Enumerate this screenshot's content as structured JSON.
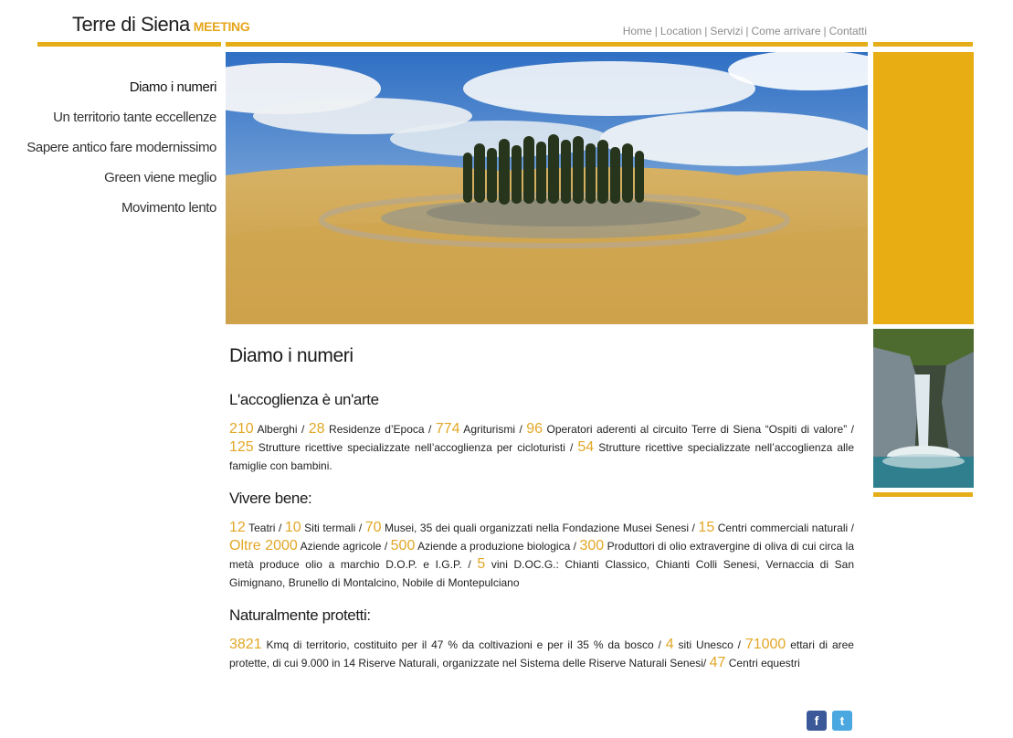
{
  "header": {
    "logo_main": "Terre di Siena",
    "logo_sub": "MEETING",
    "nav": [
      "Home",
      "Location",
      "Servizi",
      "Come arrivare",
      "Contatti"
    ]
  },
  "leftmenu": [
    "Diamo i numeri",
    "Un territorio tante eccellenze",
    "Sapere antico fare modernissimo",
    "Green viene meglio",
    "Movimento lento"
  ],
  "content": {
    "title": "Diamo i numeri",
    "sections": [
      {
        "heading": "L'accoglienza è un'arte",
        "parts": [
          [
            "210",
            " Alberghi / "
          ],
          [
            "28",
            " Residenze d’Epoca / "
          ],
          [
            "774",
            " Agriturismi / "
          ],
          [
            "96",
            " Operatori aderenti al circuito Terre di Siena “Ospiti di valore” / "
          ],
          [
            "125",
            " Strutture ricettive specializzate nell’accoglienza per cicloturisti / "
          ],
          [
            "54",
            " Strutture ricettive specializzate nell’accoglienza alle famiglie con bambini."
          ]
        ]
      },
      {
        "heading": "Vivere bene:",
        "parts": [
          [
            "12",
            " Teatri / "
          ],
          [
            "10",
            " Siti termali / "
          ],
          [
            "70",
            " Musei, 35 dei quali organizzati nella Fondazione Musei Senesi / "
          ],
          [
            "15",
            " Centri commerciali naturali / "
          ],
          [
            "Oltre 2000",
            " Aziende agricole / "
          ],
          [
            "500",
            " Aziende a produzione biologica / "
          ],
          [
            "300",
            " Produttori di olio extravergine di oliva di cui circa la metà produce olio a marchio D.O.P. e I.G.P. / "
          ],
          [
            "5",
            " vini D.OC.G.: Chianti Classico, Chianti Colli Senesi, Vernaccia di San Gimignano, Brunello di Montalcino, Nobile di Montepulciano"
          ]
        ]
      },
      {
        "heading": "Naturalmente protetti:",
        "parts": [
          [
            "3821",
            " Kmq di territorio, costituito per il 47 % da coltivazioni e per il 35 % da bosco / "
          ],
          [
            "4",
            " siti Unesco / "
          ],
          [
            "71000",
            " ettari di aree protette, di cui 9.000 in 14 Riserve Naturali, organizzate nel Sistema delle Riserve Naturali Senesi/ "
          ],
          [
            "47",
            " Centri equestri"
          ]
        ]
      }
    ]
  },
  "social": {
    "facebook_icon": "facebook-icon",
    "twitter_icon": "twitter-icon"
  },
  "colors": {
    "accent": "#e5ad18",
    "number": "#e2a726"
  }
}
